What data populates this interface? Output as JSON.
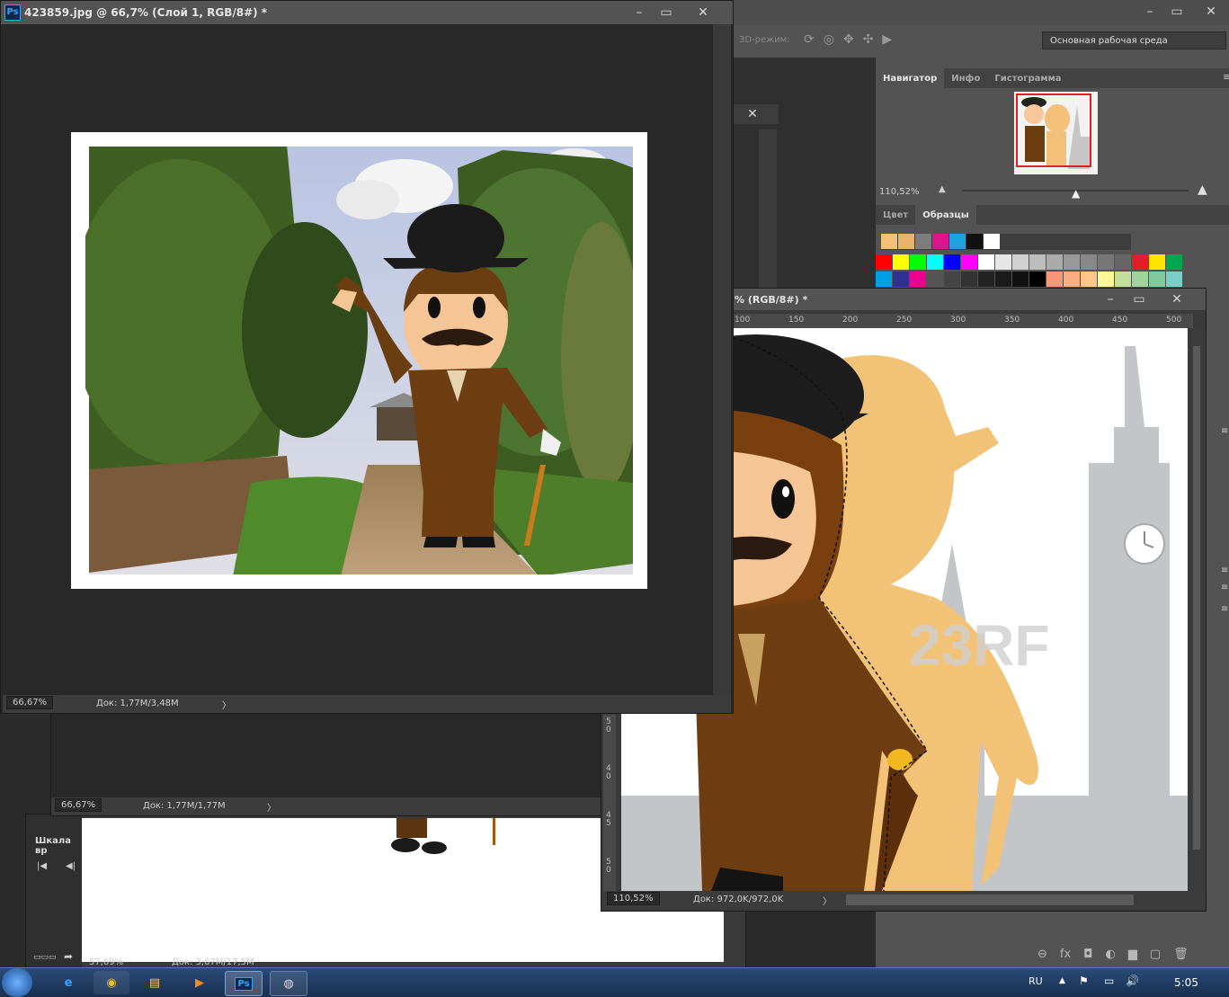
{
  "main_window": {
    "title": "423859.jpg @ 66,7% (Слой 1, RGB/8#) *",
    "zoom": "66,67%",
    "doc_info": "Док: 1,77M/3,48M"
  },
  "app_bar": {
    "mode_3d": "3D-режим:",
    "workspace": "Основная рабочая среда"
  },
  "navigator": {
    "tabs": [
      "Навигатор",
      "Инфо",
      "Гистограмма"
    ],
    "zoom": "110,52%"
  },
  "swatches_panel": {
    "tabs": [
      "Цвет",
      "Образцы"
    ],
    "recent": [
      "#f2c078",
      "#e8b46b",
      "#7c7c7c",
      "#e0138c",
      "#1fa3e0",
      "#111111",
      "#ffffff"
    ],
    "row1": [
      "#ff0000",
      "#ffff00",
      "#00ff00",
      "#00ffff",
      "#0000ff",
      "#ff00ff",
      "#ffffff",
      "#e6e6e6",
      "#d0d0d0",
      "#bdbdbd",
      "#aaaaaa",
      "#999999",
      "#888888",
      "#777777",
      "#666666",
      "#e41e26",
      "#ffe600",
      "#00a650"
    ],
    "row2": [
      "#00a0e9",
      "#2e3192",
      "#ec008c",
      "#555555",
      "#444444",
      "#333333",
      "#222222",
      "#1a1a1a",
      "#111111",
      "#000000",
      "#f7977a",
      "#f9ad81",
      "#fdc68a",
      "#fff79a",
      "#c4df9b",
      "#a3d39c",
      "#82ca9d",
      "#7bcdc8"
    ]
  },
  "second_window": {
    "title": "% (RGB/8#) *",
    "zoom": "110,52%",
    "doc_info": "Док: 972,0K/972,0K",
    "ruler_marks": [
      "100",
      "150",
      "200",
      "250",
      "300",
      "350",
      "400",
      "450",
      "500"
    ],
    "vruler_marks": [
      "5\n0",
      "4\n0",
      "4\n5",
      "5\n0"
    ],
    "watermark": "23RF"
  },
  "back_window1": {
    "zoom": "66,67%",
    "doc_info": "Док: 1,77M/1,77M"
  },
  "back_window2": {
    "zoom": "57,69%",
    "doc_info": "Док: 3,67M/17,5M"
  },
  "timeline": {
    "label": "Шкала вр"
  },
  "taskbar": {
    "lang": "RU",
    "time": "5:05"
  }
}
